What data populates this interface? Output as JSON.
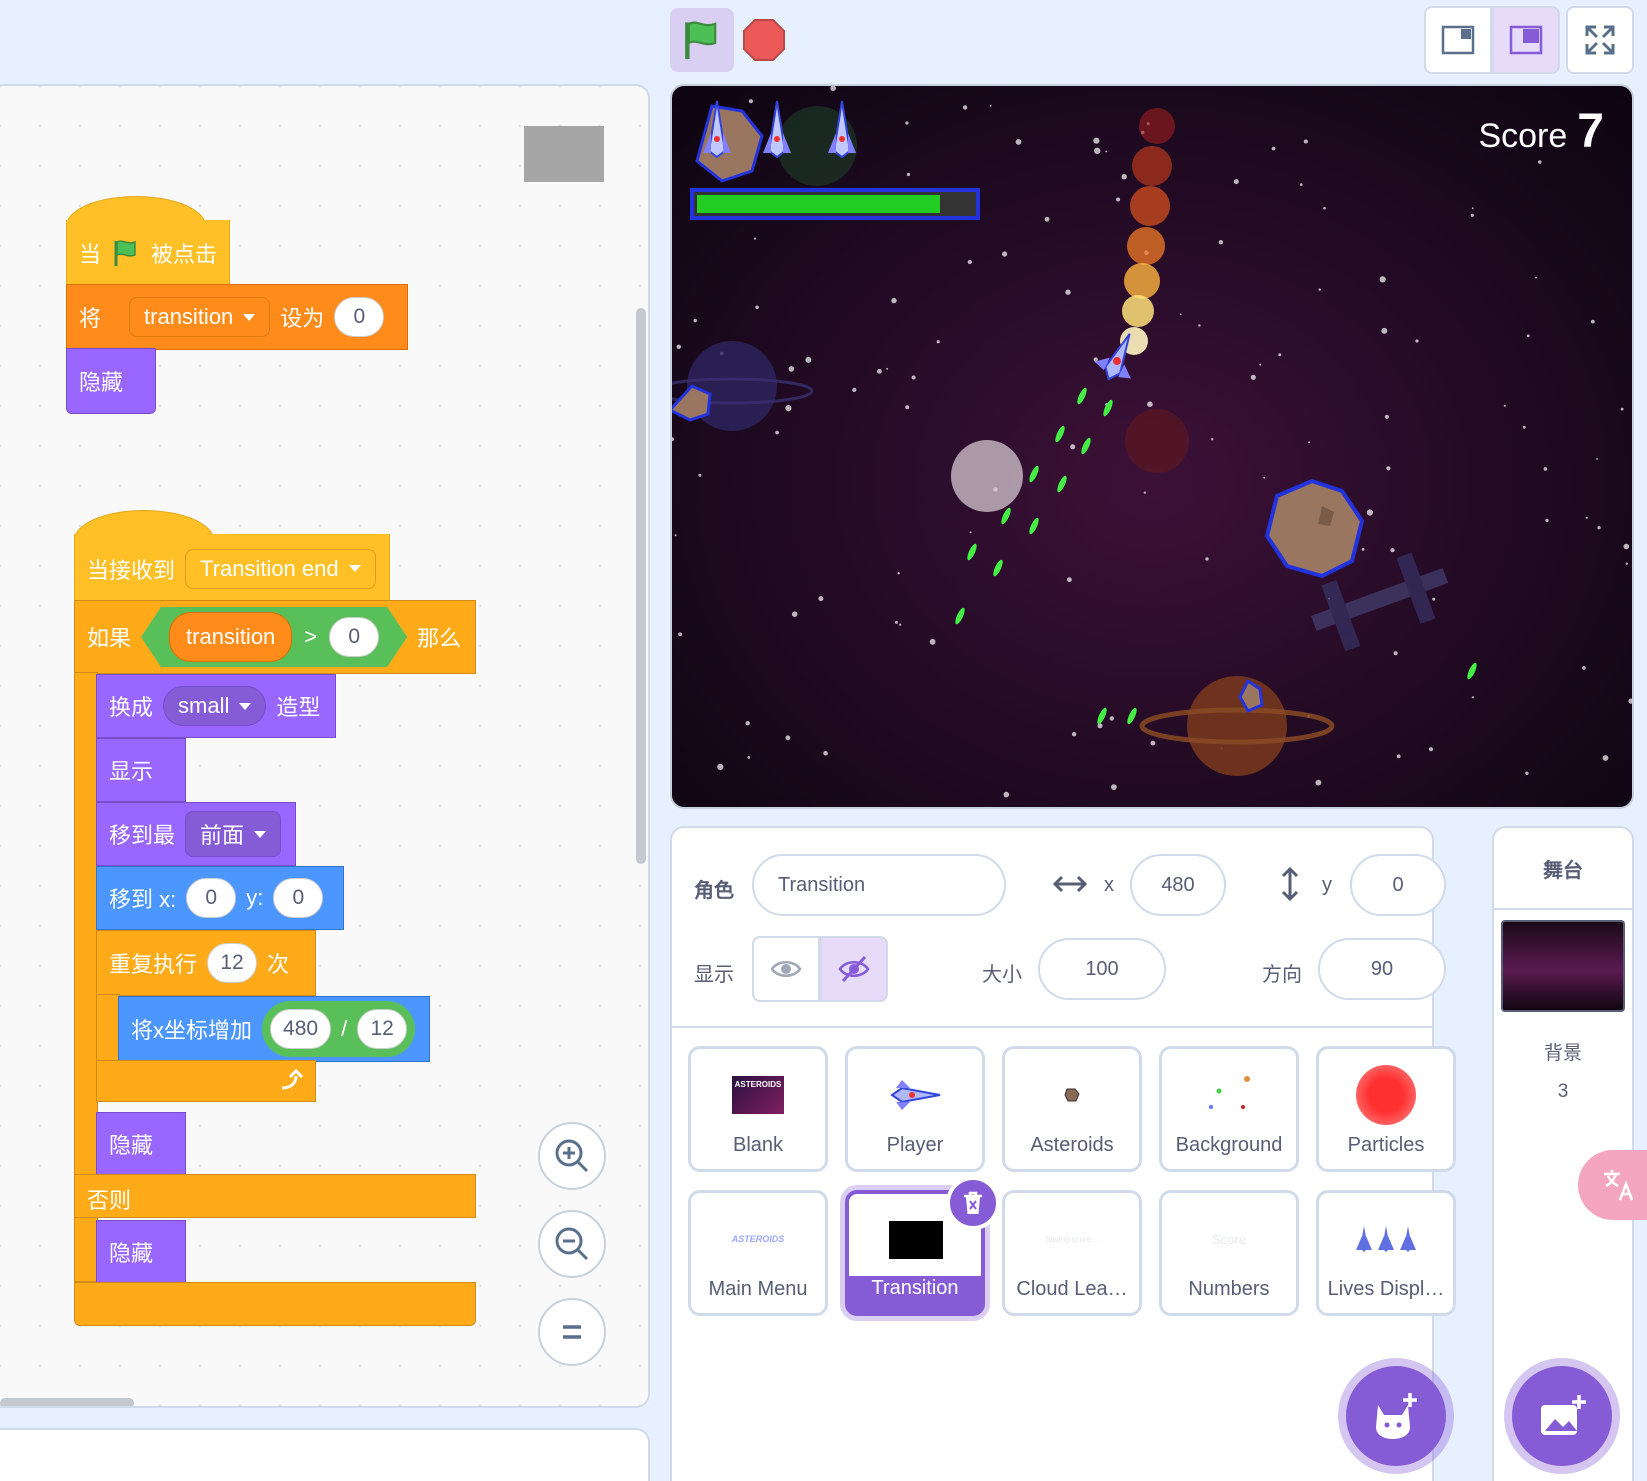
{
  "code": {
    "script1": {
      "hat_when": "当",
      "hat_clicked": "被点击",
      "set_label": "将",
      "set_var": "transition",
      "set_to": "设为",
      "set_value": "0",
      "hide": "隐藏"
    },
    "script2": {
      "hat_receive": "当接收到",
      "hat_message": "Transition end",
      "if_label": "如果",
      "cond_var": "transition",
      "cond_op": ">",
      "cond_value": "0",
      "then_label": "那么",
      "switch_label": "换成",
      "switch_costume": "small",
      "switch_suffix": "造型",
      "show": "显示",
      "goto_layer": "移到最",
      "goto_layer_value": "前面",
      "goto_x_label": "移到 x:",
      "goto_x": "0",
      "goto_y_label": "y:",
      "goto_y": "0",
      "repeat_label": "重复执行",
      "repeat_count": "12",
      "repeat_suffix": "次",
      "change_x_label": "将x坐标增加",
      "div_a": "480",
      "div_op": "/",
      "div_b": "12",
      "hide1": "隐藏",
      "else_label": "否则",
      "hide2": "隐藏"
    }
  },
  "stage": {
    "score_label": "Score",
    "score_value": "7",
    "health_fraction": 0.88,
    "colors": {
      "health_fill": "#22cc22",
      "health_border": "#2233dd"
    }
  },
  "sprite_info": {
    "sprite_label": "角色",
    "sprite_name": "Transition",
    "x_label": "x",
    "x_value": "480",
    "y_label": "y",
    "y_value": "0",
    "show_label": "显示",
    "size_label": "大小",
    "size_value": "100",
    "direction_label": "方向",
    "direction_value": "90"
  },
  "sprites": [
    {
      "name": "Blank",
      "thumb": "ASTEROIDS"
    },
    {
      "name": "Player",
      "thumb": ""
    },
    {
      "name": "Asteroids",
      "thumb": ""
    },
    {
      "name": "Background",
      "thumb": ""
    },
    {
      "name": "Particles",
      "thumb": ""
    },
    {
      "name": "Main Menu",
      "thumb": "ASTEROIDS"
    },
    {
      "name": "Transition",
      "thumb": ""
    },
    {
      "name": "Cloud Lea…",
      "thumb": "Saving score…"
    },
    {
      "name": "Numbers",
      "thumb": "Score"
    },
    {
      "name": "Lives Displ…",
      "thumb": ""
    }
  ],
  "stage_panel": {
    "title": "舞台",
    "backdrops_label": "背景",
    "backdrops_count": "3"
  },
  "colors": {
    "accent": "#855cd6",
    "background": "#e6f0ff"
  }
}
